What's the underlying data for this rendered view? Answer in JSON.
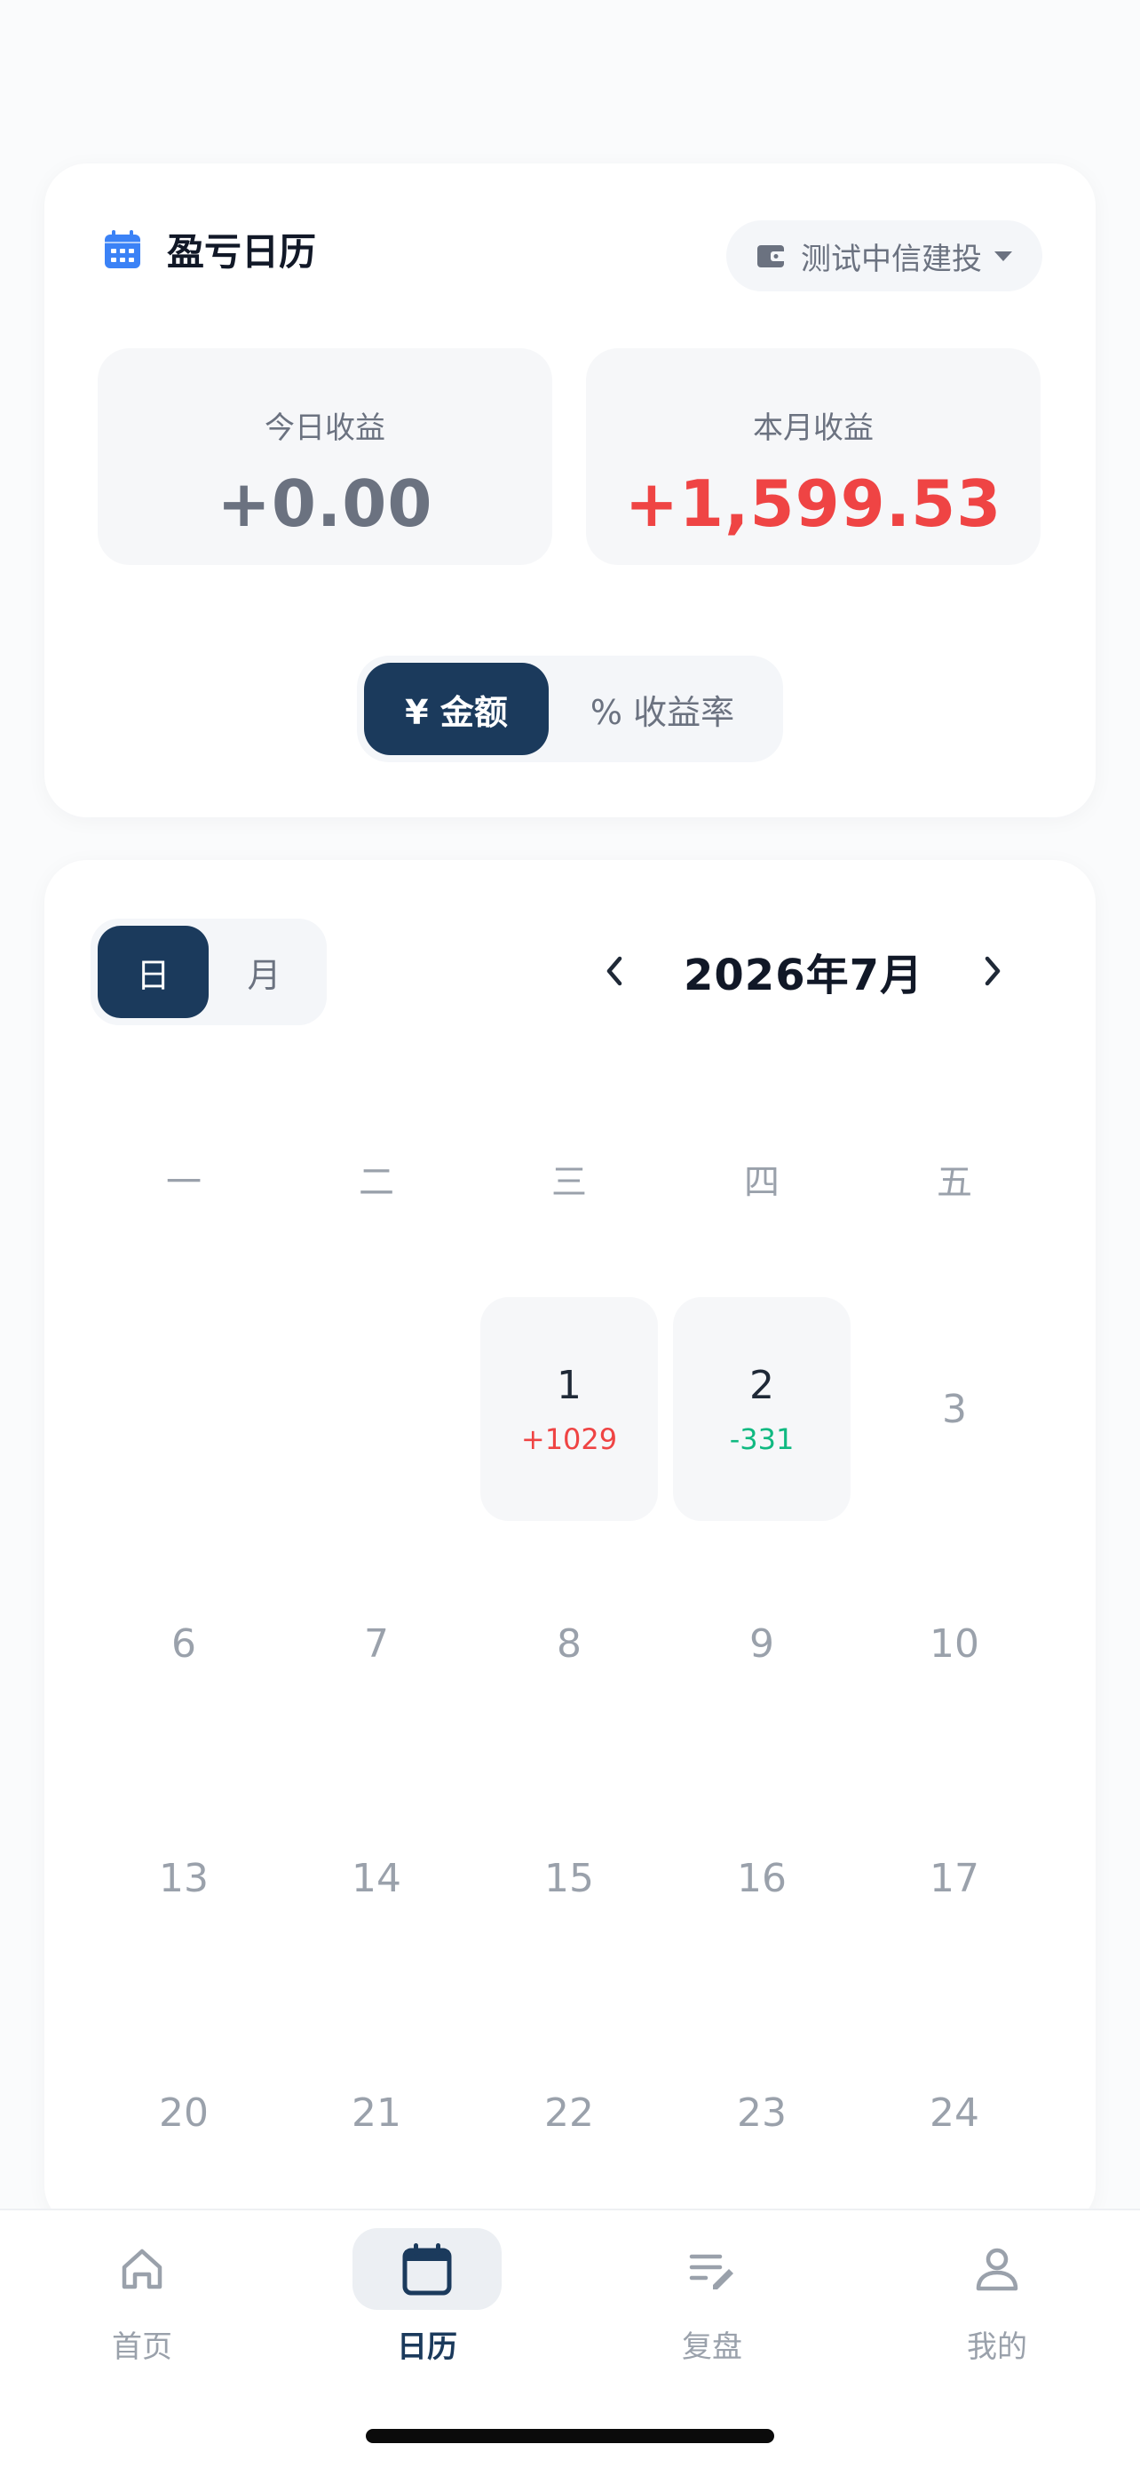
{
  "header": {
    "title": "盈亏日历",
    "account": "测试中信建投"
  },
  "stats": {
    "today_label": "今日收益",
    "today_value": "+0.00",
    "month_label": "本月收益",
    "month_value": "+1,599.53"
  },
  "mode_toggle": {
    "amount": "¥ 金额",
    "rate": "% 收益率",
    "selected": "amount"
  },
  "calendar": {
    "view_day": "日",
    "view_month": "月",
    "month_label": "2026年7月",
    "weekdays": [
      "一",
      "二",
      "三",
      "四",
      "五"
    ],
    "days": [
      {
        "num": "1",
        "pnl": "+1029",
        "trend": "up"
      },
      {
        "num": "2",
        "pnl": "-331",
        "trend": "down"
      },
      {
        "num": "3"
      },
      {
        "num": "6"
      },
      {
        "num": "7"
      },
      {
        "num": "8"
      },
      {
        "num": "9"
      },
      {
        "num": "10"
      },
      {
        "num": "13"
      },
      {
        "num": "14"
      },
      {
        "num": "15"
      },
      {
        "num": "16"
      },
      {
        "num": "17"
      },
      {
        "num": "20"
      },
      {
        "num": "21"
      },
      {
        "num": "22"
      },
      {
        "num": "23"
      },
      {
        "num": "24"
      }
    ]
  },
  "nav": {
    "home": "首页",
    "calendar": "日历",
    "review": "复盘",
    "me": "我的",
    "active": "calendar"
  },
  "colors": {
    "accent": "#1b3a5c",
    "profit": "#ef4444",
    "loss": "#10b981",
    "calendar_icon": "#3b82f6"
  }
}
